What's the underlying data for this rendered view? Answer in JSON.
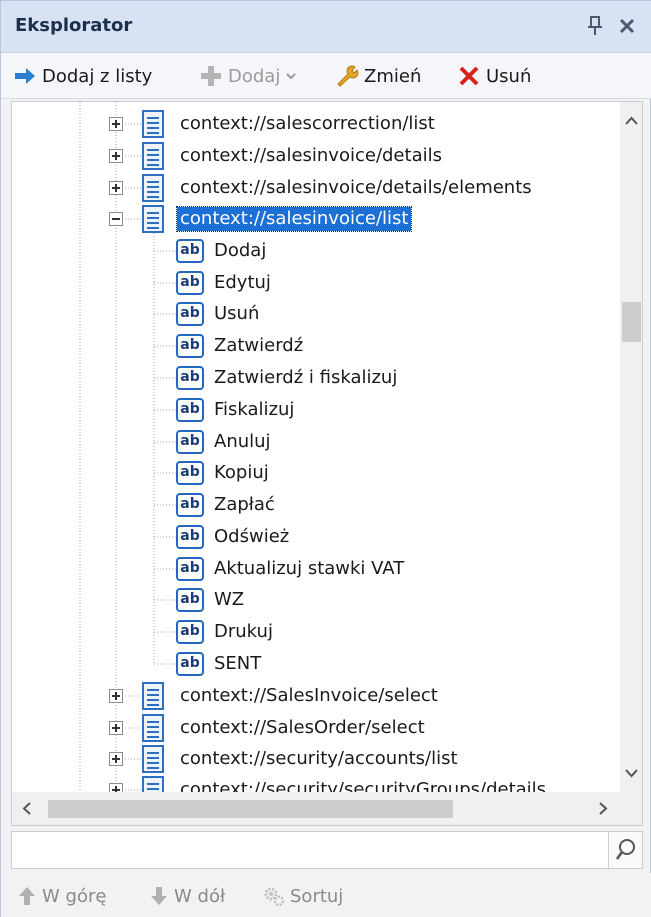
{
  "window": {
    "title": "Eksplorator"
  },
  "toolbar": {
    "add_from_list": "Dodaj z listy",
    "add": "Dodaj",
    "change": "Zmień",
    "delete": "Usuń"
  },
  "tree": {
    "nodes": [
      {
        "label": "context://salescorrection/list",
        "expanded": false
      },
      {
        "label": "context://salesinvoice/details",
        "expanded": false
      },
      {
        "label": "context://salesinvoice/details/elements",
        "expanded": false
      },
      {
        "label": "context://salesinvoice/list",
        "expanded": true,
        "selected": true
      },
      {
        "label": "context://SalesInvoice/select",
        "expanded": false
      },
      {
        "label": "context://SalesOrder/select",
        "expanded": false
      },
      {
        "label": "context://security/accounts/list",
        "expanded": false
      },
      {
        "label": "context://security/securityGroups/details",
        "expanded": false
      }
    ],
    "children": [
      "Dodaj",
      "Edytuj",
      "Usuń",
      "Zatwierdź",
      "Zatwierdź i fiskalizuj",
      "Fiskalizuj",
      "Anuluj",
      "Kopiuj",
      "Zapłać",
      "Odśwież",
      "Aktualizuj stawki VAT",
      "WZ",
      "Drukuj",
      "SENT"
    ],
    "child_icon_label": "ab"
  },
  "search": {
    "value": "",
    "placeholder": ""
  },
  "bottom": {
    "up": "W górę",
    "down": "W dół",
    "sort": "Sortuj"
  },
  "colors": {
    "titlebar": "#d7e3f3",
    "selection": "#1c6fd4",
    "accent_blue": "#2467c0"
  }
}
